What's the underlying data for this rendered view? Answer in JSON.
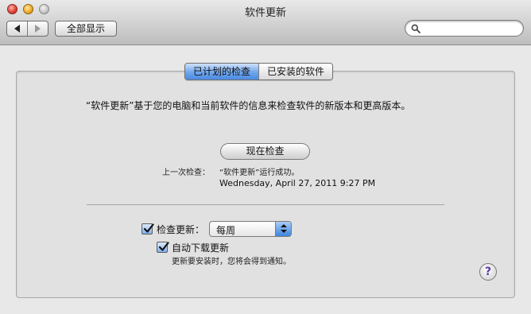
{
  "window": {
    "title": "软件更新"
  },
  "toolbar": {
    "show_all_label": "全部显示",
    "search": {
      "value": "",
      "placeholder": ""
    }
  },
  "tabs": [
    {
      "label": "已计划的检查",
      "active": true
    },
    {
      "label": "已安装的软件",
      "active": false
    }
  ],
  "main": {
    "description": "“软件更新”基于您的电脑和当前软件的信息来检查软件的新版本和更高版本。",
    "check_now_label": "现在检查",
    "last_check_label": "上一次检查：",
    "last_check_status": "“软件更新”运行成功。",
    "last_check_date": "Wednesday, April 27, 2011 9:27 PM",
    "check_updates": {
      "label": "检查更新：",
      "checked": true,
      "frequency": "每周"
    },
    "auto_download": {
      "label": "自动下载更新",
      "checked": true,
      "note": "更新要安装时，您将会得到通知。"
    },
    "help_label": "?"
  },
  "colors": {
    "accent": "#4b8be3",
    "help_glyph": "#5b3aa2"
  }
}
